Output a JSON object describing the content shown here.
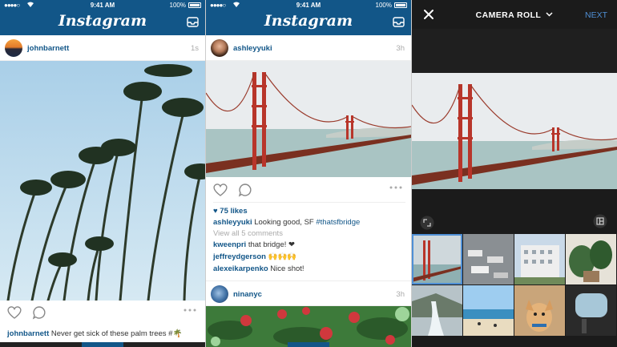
{
  "status": {
    "time": "9:41 AM",
    "battery": "100%"
  },
  "app": {
    "logo": "Instagram"
  },
  "feed1": {
    "user": "johnbarnett",
    "time": "1s",
    "caption_user": "johnbarnett",
    "caption_text": "Never get sick of these palm trees #",
    "caption_emoji": "🌴"
  },
  "feed2": {
    "user": "ashleyyuki",
    "time": "3h",
    "likes": "75 likes",
    "caption_user": "ashleyyuki",
    "caption_text": "Looking good, SF",
    "caption_tag": "#thatsfbridge",
    "view_all": "View all 5 comments",
    "comments": [
      {
        "user": "kweenpri",
        "text": "that bridge! ❤"
      },
      {
        "user": "jeffreydgerson",
        "text": "🙌🙌🙌"
      },
      {
        "user": "alexeikarpenko",
        "text": "Nice shot!"
      }
    ],
    "next_user": "ninanyc",
    "next_time": "3h"
  },
  "camera_roll": {
    "title": "CAMERA ROLL",
    "next_label": "NEXT"
  },
  "colors": {
    "brand": "#125688",
    "accent": "#4f8fd5",
    "dark": "#1b1b1b"
  },
  "icons": [
    "inbox-icon",
    "heart-icon",
    "comment-icon",
    "more-icon",
    "close-icon",
    "chevron-down-icon",
    "expand-icon",
    "layout-icon"
  ]
}
